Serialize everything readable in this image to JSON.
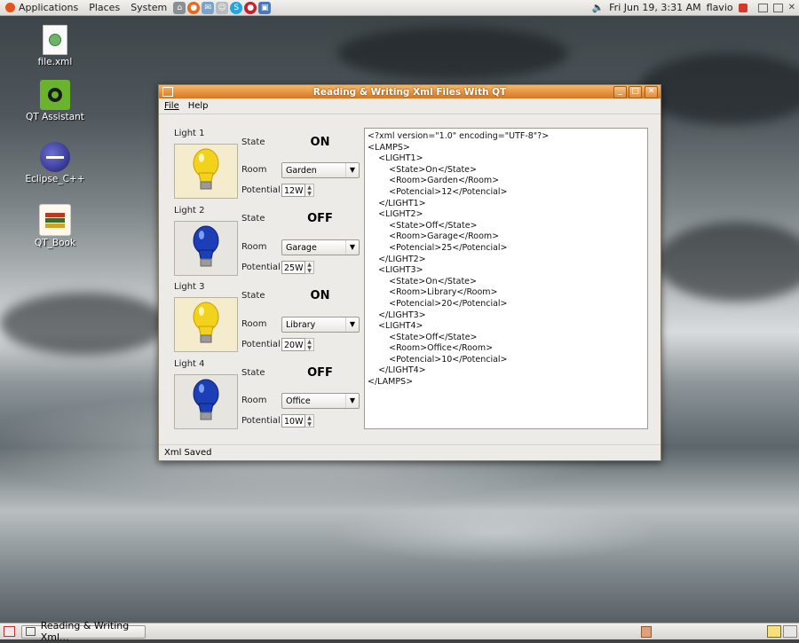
{
  "top_panel": {
    "menus": [
      "Applications",
      "Places",
      "System"
    ],
    "datetime": "Fri Jun 19,  3:31 AM",
    "user": "flavio"
  },
  "desktop": {
    "icons": [
      {
        "label": "file.xml",
        "icon": "xml-file-icon"
      },
      {
        "label": "QT Assistant",
        "icon": "qt-assistant-icon"
      },
      {
        "label": "Eclipse_C++",
        "icon": "eclipse-icon"
      },
      {
        "label": "QT_Book",
        "icon": "book-stack-icon"
      }
    ]
  },
  "window": {
    "title": "Reading & Writing Xml Files With QT",
    "menu": [
      "File",
      "Help"
    ],
    "lamps": [
      {
        "title": "Light 1",
        "state_label": "State",
        "state": "ON",
        "room_label": "Room",
        "room": "Garden",
        "potential_label": "Potential",
        "potential": "12W",
        "bulb_color": "#f2d21b"
      },
      {
        "title": "Light 2",
        "state_label": "State",
        "state": "OFF",
        "room_label": "Room",
        "room": "Garage",
        "potential_label": "Potential",
        "potential": "25W",
        "bulb_color": "#1c3fb8"
      },
      {
        "title": "Light 3",
        "state_label": "State",
        "state": "ON",
        "room_label": "Room",
        "room": "Library",
        "potential_label": "Potential",
        "potential": "20W",
        "bulb_color": "#f2d21b"
      },
      {
        "title": "Light 4",
        "state_label": "State",
        "state": "OFF",
        "room_label": "Room",
        "room": "Office",
        "potential_label": "Potential",
        "potential": "10W",
        "bulb_color": "#1c3fb8"
      }
    ],
    "xml_lines": [
      "<?xml version=\"1.0\" encoding=\"UTF-8\"?>",
      "<LAMPS>",
      "    <LIGHT1>",
      "        <State>On</State>",
      "        <Room>Garden</Room>",
      "        <Potencial>12</Potencial>",
      "    </LIGHT1>",
      "    <LIGHT2>",
      "        <State>Off</State>",
      "        <Room>Garage</Room>",
      "        <Potencial>25</Potencial>",
      "    </LIGHT2>",
      "    <LIGHT3>",
      "        <State>On</State>",
      "        <Room>Library</Room>",
      "        <Potencial>20</Potencial>",
      "    </LIGHT3>",
      "    <LIGHT4>",
      "        <State>Off</State>",
      "        <Room>Office</Room>",
      "        <Potencial>10</Potencial>",
      "    </LIGHT4>",
      "</LAMPS>"
    ],
    "status": "Xml Saved"
  },
  "bottom_panel": {
    "task": "Reading & Writing Xml..."
  }
}
